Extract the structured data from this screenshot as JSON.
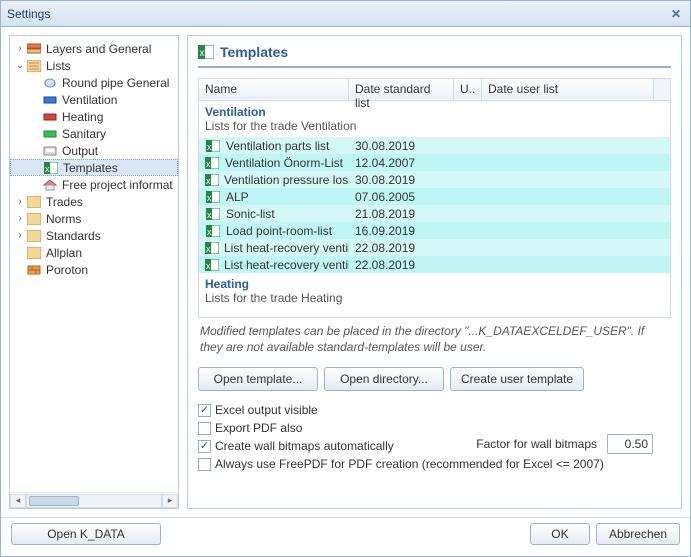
{
  "window": {
    "title": "Settings"
  },
  "tree": {
    "layers_general": "Layers and General",
    "lists": "Lists",
    "round_pipe": "Round pipe General",
    "ventilation": "Ventilation",
    "heating": "Heating",
    "sanitary": "Sanitary",
    "output": "Output",
    "templates": "Templates",
    "free_project": "Free project informat",
    "trades": "Trades",
    "norms": "Norms",
    "standards": "Standards",
    "allplan": "Allplan",
    "poroton": "Poroton"
  },
  "content": {
    "header": "Templates",
    "columns": {
      "name": "Name",
      "dstd": "Date standard list",
      "u": "U..",
      "duser": "Date user list"
    },
    "groups": [
      {
        "title": "Ventilation",
        "subtitle": "Lists for the trade Ventilation",
        "hl": "cyan",
        "rows": [
          {
            "name": "Ventilation parts list",
            "dstd": "30.08.2019"
          },
          {
            "name": "Ventilation Önorm-List",
            "dstd": "12.04.2007"
          },
          {
            "name": "Ventilation pressure loss",
            "dstd": "30.08.2019"
          },
          {
            "name": "ALP",
            "dstd": "07.06.2005"
          },
          {
            "name": "Sonic-list",
            "dstd": "21.08.2019"
          },
          {
            "name": "Load point-room-list",
            "dstd": "16.09.2019"
          },
          {
            "name": "List heat-recovery ventil...",
            "dstd": "22.08.2019"
          },
          {
            "name": "List heat-recovery ventil...",
            "dstd": "22.08.2019"
          }
        ]
      },
      {
        "title": "Heating",
        "subtitle": "Lists for the trade Heating",
        "hl": "red",
        "rows": []
      }
    ],
    "note": "Modified templates can be placed in the directory \"...K_DATAEXCELDEF_USER\". If they are not available standard-templates will be user.",
    "buttons": {
      "open_tpl": "Open template...",
      "open_dir": "Open directory...",
      "create_user": "Create user template"
    },
    "checks": {
      "excel_visible": "Excel output visible",
      "export_pdf": "Export PDF also",
      "wall_bitmaps": "Create wall bitmaps automatically",
      "freepdf": "Always use FreePDF for PDF creation (recommended for Excel <= 2007)"
    },
    "factor_label": "Factor for wall bitmaps",
    "factor_value": "0.50"
  },
  "footer": {
    "open_kdata": "Open K_DATA",
    "ok": "OK",
    "cancel": "Abbrechen"
  }
}
